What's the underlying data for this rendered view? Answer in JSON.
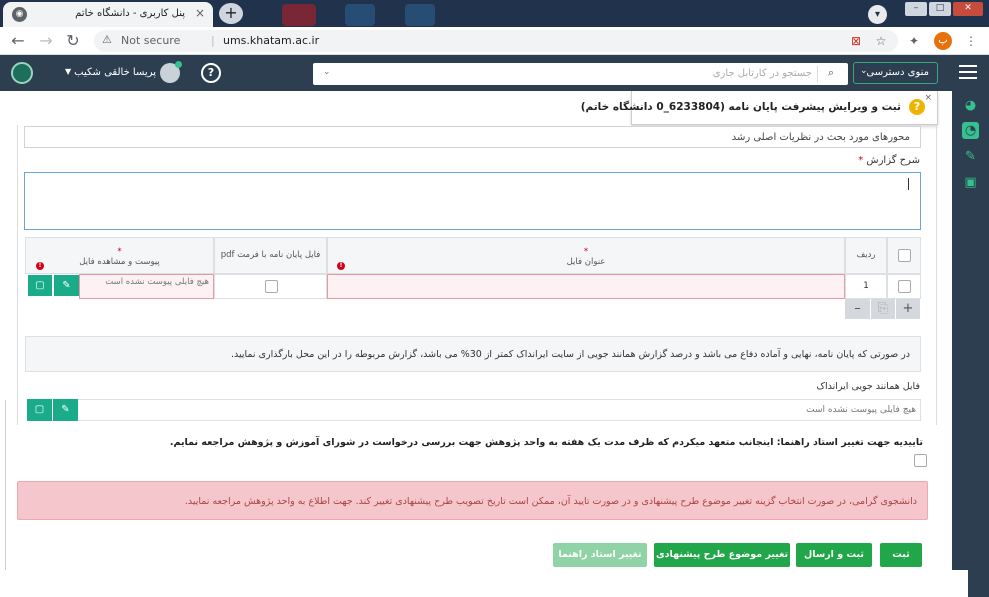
{
  "browser": {
    "tab_title": "پنل کاربری - دانشگاه خاتم",
    "tab_close": "×",
    "new_tab": "+",
    "url": "ums.khatam.ac.ir",
    "security": "Not secure",
    "profile_initial": "پ"
  },
  "header": {
    "access_label": "منوی دسترسی",
    "search_placeholder": "جستجو در کارتابل جاری",
    "user_name": "پریسا خالقی شکیب",
    "help": "?"
  },
  "dialog": {
    "title": "ثبت و ویرایش پیشرفت پایان نامه (6233804_0 دانشگاه خاتم)",
    "close": "×"
  },
  "form": {
    "topic_value": "محورهای مورد بحث در نظریات اصلی رشد",
    "desc_label": "شرح گزارش",
    "required_mark": "*",
    "table": {
      "col_row": "ردیف",
      "col_title": "عنوان فایل",
      "col_pdf": "فایل پایان نامه با فرمت pdf",
      "col_attach": "پیوست و مشاهده فایل",
      "row_number": "1",
      "no_file": "هیچ فایلی پیوست نشده است"
    },
    "info_text": "در صورتی که پایان نامه، نهایی و آماده دفاع می باشد و درصد گزارش همانند جویی از سایت ایرانداک کمتر از 30% می باشد، گزارش مربوطه را در این محل بارگذاری نمایید.",
    "similarity_label": "فایل همانند جویی ایرانداک",
    "similarity_no_file": "هیچ فایلی پیوست نشده است",
    "confirm_text": "تاییدیه جهت تغییر استاد راهنما: اینجانب متعهد میکردم که ظرف مدت یک هفته به واحد پژوهش جهت بررسی درخواست در شورای آموزش و پژوهش مراجعه نمایم.",
    "alert_text": "دانشجوی گرامی، در صورت انتخاب گزینه تغییر موضوع طرح پیشنهادی و در صورت تایید آن، ممکن است تاریخ تصویب طرح پیشنهادی تغییر کند. جهت اطلاع به واحد پژوهش مراجعه نمایید."
  },
  "actions": {
    "submit": "ثبت",
    "submit_send": "ثبت و ارسال",
    "change_topic": "تغییر موضوع طرح پیشنهادی",
    "change_advisor": "تغییر استاد راهنما"
  },
  "colors": {
    "header_bg": "#2d3e50",
    "accent_green": "#1aab8a",
    "button_green": "#22a64a",
    "alert_bg": "#f5c6cb"
  }
}
